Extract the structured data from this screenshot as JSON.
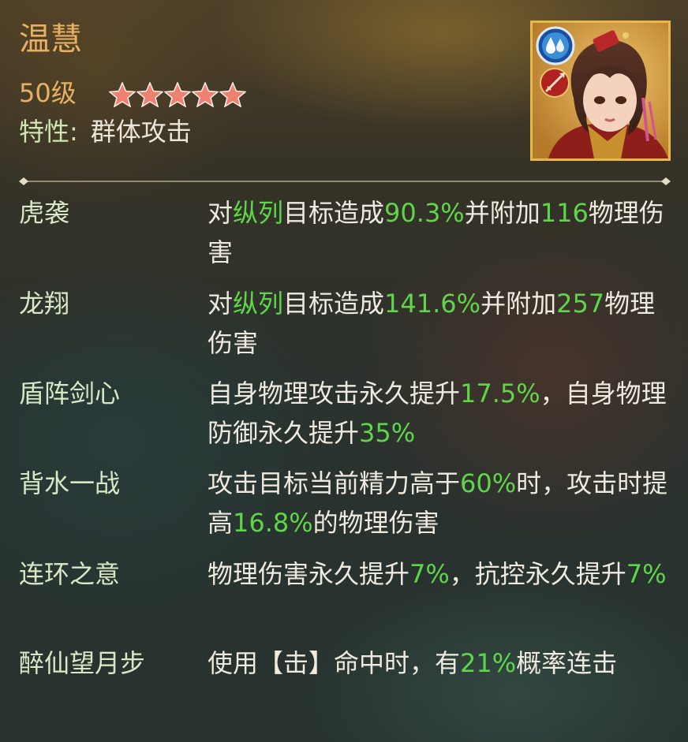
{
  "hero": {
    "name": "温慧",
    "level": "50级",
    "stars": 5,
    "star_color": "#f08070",
    "trait_label": "特性:",
    "trait_value": "群体攻击"
  },
  "portrait": {
    "element_icon": "water-drops-icon",
    "class_icon": "spear-icon",
    "frame_color": "#e6b84a"
  },
  "skills": [
    {
      "name": "虎袭",
      "desc": [
        {
          "t": "对"
        },
        {
          "t": "纵列",
          "hl": true
        },
        {
          "t": "目标造成"
        },
        {
          "t": "90.3%",
          "hl": true
        },
        {
          "t": "并附加"
        },
        {
          "t": "116",
          "hl": true
        },
        {
          "t": "物理伤害"
        }
      ]
    },
    {
      "name": "龙翔",
      "desc": [
        {
          "t": "对"
        },
        {
          "t": "纵列",
          "hl": true
        },
        {
          "t": "目标造成"
        },
        {
          "t": "141.6%",
          "hl": true
        },
        {
          "t": "并附加"
        },
        {
          "t": "257",
          "hl": true
        },
        {
          "t": "物理伤害"
        }
      ]
    },
    {
      "name": "盾阵剑心",
      "desc": [
        {
          "t": "自身物理攻击永久提升"
        },
        {
          "t": "17.5%",
          "hl": true
        },
        {
          "t": "，自身物理防御永久提升"
        },
        {
          "t": "35%",
          "hl": true
        }
      ]
    },
    {
      "name": "背水一战",
      "desc": [
        {
          "t": "攻击目标当前精力高于"
        },
        {
          "t": "60%",
          "hl": true
        },
        {
          "t": "时，攻击时提高"
        },
        {
          "t": "16.8%",
          "hl": true
        },
        {
          "t": "的物理伤害"
        }
      ]
    },
    {
      "name": "连环之意",
      "desc": [
        {
          "t": "物理伤害永久提升"
        },
        {
          "t": "7%",
          "hl": true
        },
        {
          "t": "，抗控永久提升"
        },
        {
          "t": "7%",
          "hl": true
        }
      ]
    },
    {
      "name": "醉仙望月步",
      "desc": [
        {
          "t": "使用【击】命中时，有"
        },
        {
          "t": "21%",
          "hl": true
        },
        {
          "t": "概率连击"
        }
      ]
    }
  ],
  "colors": {
    "name_gold": "#e8b063",
    "highlight_green": "#5fd64a",
    "text_light": "#efeadf",
    "skill_name": "#d8e8c6"
  }
}
